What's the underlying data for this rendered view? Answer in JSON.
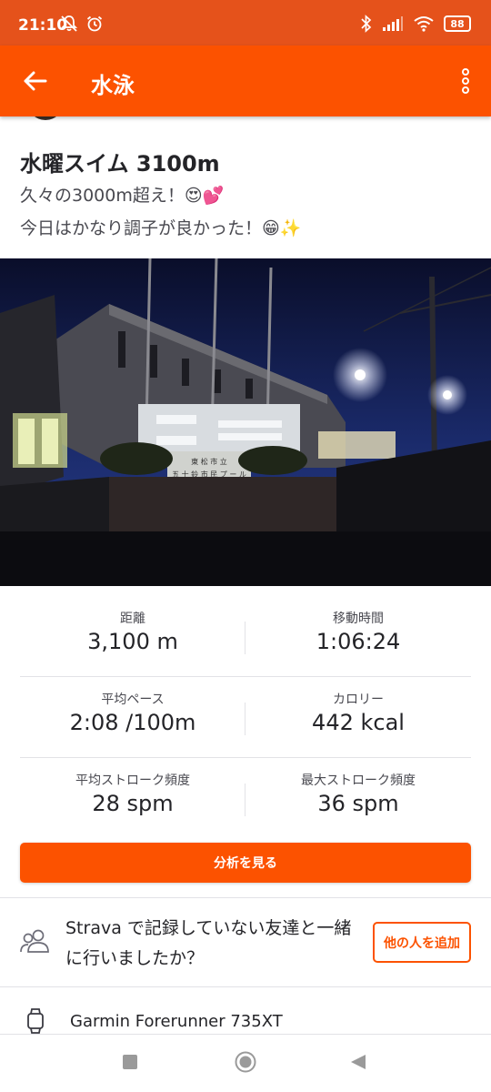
{
  "status_bar": {
    "time": "21:10",
    "battery": "88",
    "icons": [
      "notifications-off-icon",
      "alarm-icon",
      "bluetooth-icon",
      "signal-icon",
      "wifi-icon",
      "battery-icon"
    ]
  },
  "app_bar": {
    "title": "水泳",
    "color": "#fc5200"
  },
  "activity": {
    "title": "水曜スイム 3100m",
    "description_lines": [
      "久々の3000m超え！😍💕",
      "今日はかなり調子が良かった！😁✨"
    ],
    "photo": {
      "sign_line1": "東 松 市 立",
      "sign_line2": "五 十 鈴 市 民 プ ー ル"
    }
  },
  "stats": [
    {
      "label": "距離",
      "value": "3,100 m"
    },
    {
      "label": "移動時間",
      "value": "1:06:24"
    },
    {
      "label": "平均ペース",
      "value": "2:08 /100m"
    },
    {
      "label": "カロリー",
      "value": "442 kcal"
    },
    {
      "label": "平均ストローク頻度",
      "value": "28 spm"
    },
    {
      "label": "最大ストローク頻度",
      "value": "36 spm"
    }
  ],
  "analyze_button": "分析を見る",
  "friends_prompt": {
    "text": "Strava で記録していない友達と一緒に行いましたか？",
    "button": "他の人を追加"
  },
  "device": {
    "name": "Garmin Forerunner 735XT"
  }
}
